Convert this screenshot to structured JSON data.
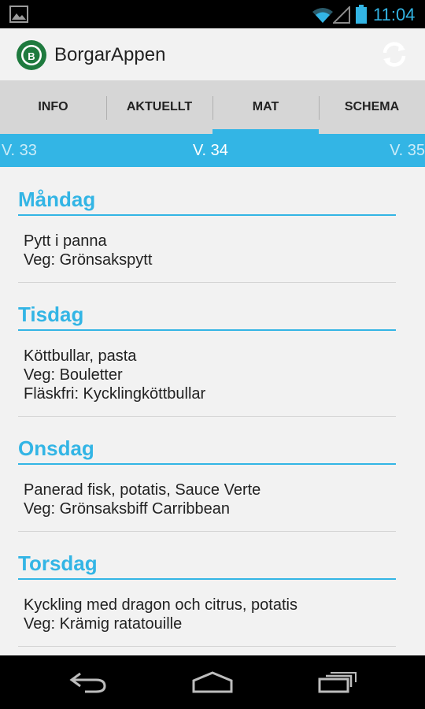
{
  "status_bar": {
    "time": "11:04",
    "icons": [
      "gallery-icon",
      "wifi-icon",
      "signal-icon",
      "battery-icon"
    ]
  },
  "app": {
    "title": "BorgarAppen",
    "logo_icon": "school-logo-icon",
    "refresh_icon": "refresh-icon"
  },
  "tabs": [
    {
      "label": "INFO",
      "active": false
    },
    {
      "label": "AKTUELLT",
      "active": false
    },
    {
      "label": "MAT",
      "active": true
    },
    {
      "label": "SCHEMA",
      "active": false
    }
  ],
  "weeks": {
    "prev": "V. 33",
    "current": "V. 34",
    "next": "V. 35"
  },
  "days": [
    {
      "name": "Måndag",
      "items": [
        "Pytt i panna",
        "Veg: Grönsakspytt"
      ]
    },
    {
      "name": "Tisdag",
      "items": [
        "Köttbullar, pasta",
        "Veg: Bouletter",
        "Fläskfri: Kycklingköttbullar"
      ]
    },
    {
      "name": "Onsdag",
      "items": [
        "Panerad fisk, potatis, Sauce Verte",
        "Veg: Grönsaksbiff Carribbean"
      ]
    },
    {
      "name": "Torsdag",
      "items": [
        "Kyckling med dragon och citrus, potatis",
        "Veg: Krämig ratatouille"
      ]
    }
  ],
  "colors": {
    "accent": "#33b5e5",
    "status_bar": "#000000",
    "tab_bar": "#d6d6d6"
  },
  "nav_bar": {
    "icons": [
      "back-icon",
      "home-icon",
      "recents-icon"
    ]
  }
}
